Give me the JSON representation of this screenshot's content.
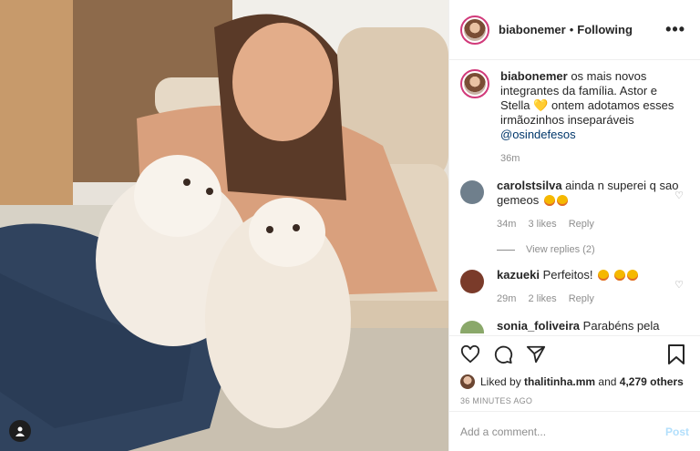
{
  "post": {
    "username": "biabonemer",
    "separator": "•",
    "follow_status": "Following",
    "more_label": "•••",
    "caption": {
      "username": "biabonemer",
      "text": "os mais novos integrantes da família. Astor e Stella",
      "heart_emoji": "💛",
      "text2": "ontem adotamos esses irmãozinhos inseparáveis",
      "mention": "@osindefesos",
      "time": "36m"
    },
    "comments": [
      {
        "username": "carolstsilva",
        "text": "ainda n superei q sao gemeos",
        "time": "34m",
        "likes": "3 likes",
        "reply": "Reply",
        "avatar_color": "#6f7f8c"
      },
      {
        "username": "kazueki",
        "text": "Perfeitos!",
        "time": "29m",
        "likes": "2 likes",
        "reply": "Reply",
        "avatar_color": "#7a3b2a"
      },
      {
        "username": "sonia_foliveira",
        "text": "Parabéns pela",
        "avatar_color": "#8aa86a"
      }
    ],
    "view_replies": "View replies (2)",
    "liked_by_prefix": "Liked by",
    "liked_by_user": "thalitinha.mm",
    "liked_by_and": "and",
    "liked_by_others": "4,279 others",
    "timestamp": "36 MINUTES AGO",
    "comment_placeholder": "Add a comment...",
    "post_button": "Post",
    "icons": [
      "heart-icon",
      "comment-icon",
      "share-icon",
      "bookmark-icon",
      "user-tag-icon"
    ]
  }
}
